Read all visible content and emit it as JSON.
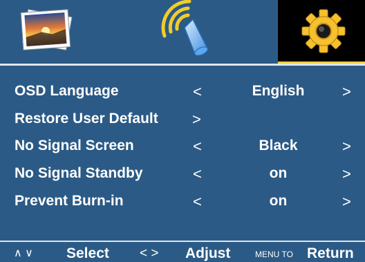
{
  "tabs": [
    {
      "name": "photo",
      "icon": "photo-icon",
      "active": false
    },
    {
      "name": "audio",
      "icon": "speaker-icon",
      "active": false
    },
    {
      "name": "setup",
      "icon": "gear-icon",
      "active": true
    }
  ],
  "menu": {
    "osd_language": {
      "label": "OSD Language",
      "left": "<",
      "value": "English",
      "right": ">"
    },
    "restore_default": {
      "label": "Restore User Default",
      "arrow": ">"
    },
    "no_signal_screen": {
      "label": "No Signal Screen",
      "left": "<",
      "value": "Black",
      "right": ">"
    },
    "no_signal_standby": {
      "label": "No Signal Standby",
      "left": "<",
      "value": "on",
      "right": ">"
    },
    "prevent_burn_in": {
      "label": "Prevent Burn-in",
      "left": "<",
      "value": "on",
      "right": ">"
    }
  },
  "footer": {
    "updown": "∧ ∨",
    "select": "Select",
    "leftright": "< >",
    "adjust": "Adjust",
    "menu_to": "MENU TO",
    "return": "Return"
  },
  "colors": {
    "background": "#2b5a86",
    "active_tab": "#000000",
    "accent": "#f2d24a",
    "text": "#ffffff"
  }
}
